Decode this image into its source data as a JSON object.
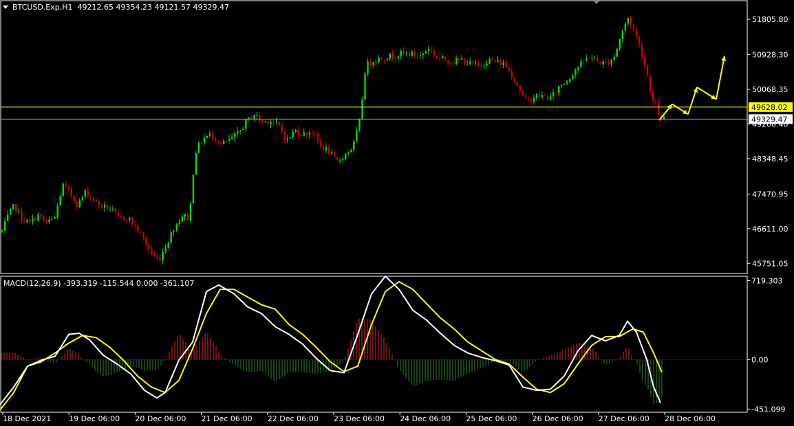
{
  "header": {
    "symbol": "BTCUSD.Exp,H1",
    "ohlc": "49212.65 49354.23 49121.57 49329.47",
    "macd_label": "MACD(12,26,9) -393.319 -115.544 0.000 -361.107"
  },
  "colors": {
    "background": "#000000",
    "bull_candle": "#00e000",
    "bear_candle": "#d00000",
    "grid_frame": "#ffffff",
    "level_line": "#ffff00",
    "bid_line": "#9aa0a8",
    "macd_line": "#ffffff",
    "signal_line": "#ffff00",
    "hist_pos": "#b02020",
    "hist_neg": "#1e6a1e",
    "arrow": "#ffff00"
  },
  "chart_data": [
    {
      "type": "candlestick",
      "title": "BTCUSD.Exp,H1",
      "ylim": [
        45500,
        52250
      ],
      "y_ticks": [
        "51805.80",
        "50928.30",
        "50068.35",
        "49208.40",
        "48348.45",
        "47470.95",
        "46611.00",
        "45751.05"
      ],
      "x_ticks": [
        "18 Dec 2021",
        "19 Dec 06:00",
        "20 Dec 06:00",
        "21 Dec 06:00",
        "22 Dec 06:00",
        "23 Dec 06:00",
        "24 Dec 06:00",
        "25 Dec 06:00",
        "26 Dec 06:00",
        "27 Dec 06:00",
        "28 Dec 06:00"
      ],
      "level_label": "49628.02",
      "bid_label": "49329.47",
      "level_value": 49628.02,
      "bid_value": 49329.47,
      "close_path": [
        [
          0,
          46550
        ],
        [
          8,
          46900
        ],
        [
          18,
          47200
        ],
        [
          28,
          46850
        ],
        [
          40,
          46750
        ],
        [
          52,
          46950
        ],
        [
          64,
          46750
        ],
        [
          76,
          46850
        ],
        [
          88,
          47700
        ],
        [
          98,
          47500
        ],
        [
          110,
          47200
        ],
        [
          122,
          47550
        ],
        [
          134,
          47300
        ],
        [
          146,
          47150
        ],
        [
          158,
          47100
        ],
        [
          170,
          46850
        ],
        [
          182,
          46900
        ],
        [
          194,
          46650
        ],
        [
          206,
          46350
        ],
        [
          218,
          45950
        ],
        [
          228,
          45850
        ],
        [
          238,
          46200
        ],
        [
          250,
          46650
        ],
        [
          262,
          46950
        ],
        [
          272,
          46850
        ],
        [
          280,
          48500
        ],
        [
          292,
          48850
        ],
        [
          305,
          48950
        ],
        [
          318,
          48700
        ],
        [
          330,
          48800
        ],
        [
          342,
          48950
        ],
        [
          354,
          49250
        ],
        [
          366,
          49450
        ],
        [
          378,
          49250
        ],
        [
          390,
          49300
        ],
        [
          402,
          49150
        ],
        [
          414,
          48800
        ],
        [
          426,
          49050
        ],
        [
          438,
          48950
        ],
        [
          450,
          49050
        ],
        [
          462,
          48650
        ],
        [
          474,
          48550
        ],
        [
          486,
          48250
        ],
        [
          498,
          48450
        ],
        [
          510,
          48650
        ],
        [
          520,
          49300
        ],
        [
          528,
          50650
        ],
        [
          540,
          50800
        ],
        [
          552,
          50850
        ],
        [
          566,
          50900
        ],
        [
          580,
          50950
        ],
        [
          594,
          50950
        ],
        [
          608,
          50900
        ],
        [
          620,
          51100
        ],
        [
          632,
          50850
        ],
        [
          644,
          50800
        ],
        [
          656,
          50750
        ],
        [
          668,
          50800
        ],
        [
          680,
          50700
        ],
        [
          694,
          50650
        ],
        [
          706,
          50800
        ],
        [
          718,
          50750
        ],
        [
          730,
          50700
        ],
        [
          742,
          50400
        ],
        [
          754,
          50000
        ],
        [
          762,
          49750
        ],
        [
          774,
          49900
        ],
        [
          786,
          49900
        ],
        [
          798,
          49850
        ],
        [
          810,
          50150
        ],
        [
          822,
          50300
        ],
        [
          832,
          50550
        ],
        [
          842,
          50700
        ],
        [
          854,
          50900
        ],
        [
          866,
          50750
        ],
        [
          878,
          50700
        ],
        [
          890,
          50900
        ],
        [
          900,
          51450
        ],
        [
          910,
          51850
        ],
        [
          918,
          51550
        ],
        [
          928,
          51050
        ],
        [
          938,
          50400
        ],
        [
          946,
          49750
        ],
        [
          952,
          49650
        ],
        [
          956,
          49250
        ],
        [
          962,
          49340
        ]
      ],
      "candle_count": 240
    },
    {
      "type": "macd",
      "title": "MACD(12,26,9)",
      "params": [
        12,
        26,
        9
      ],
      "values": {
        "macd": -393.319,
        "signal": -115.544,
        "zero": 0.0,
        "hist": -361.107
      },
      "ylim": [
        -480,
        760
      ],
      "y_ticks": [
        "719.303",
        "0.00",
        "-451.099"
      ],
      "macd_path": [
        [
          0,
          -410
        ],
        [
          20,
          -250
        ],
        [
          40,
          -60
        ],
        [
          60,
          -5
        ],
        [
          80,
          30
        ],
        [
          100,
          230
        ],
        [
          115,
          240
        ],
        [
          130,
          180
        ],
        [
          150,
          40
        ],
        [
          170,
          -40
        ],
        [
          190,
          -130
        ],
        [
          210,
          -280
        ],
        [
          228,
          -350
        ],
        [
          240,
          -300
        ],
        [
          260,
          -5
        ],
        [
          280,
          160
        ],
        [
          300,
          620
        ],
        [
          318,
          680
        ],
        [
          340,
          600
        ],
        [
          360,
          480
        ],
        [
          380,
          420
        ],
        [
          400,
          300
        ],
        [
          420,
          230
        ],
        [
          440,
          140
        ],
        [
          460,
          10
        ],
        [
          480,
          -100
        ],
        [
          500,
          -120
        ],
        [
          520,
          230
        ],
        [
          540,
          600
        ],
        [
          560,
          760
        ],
        [
          580,
          640
        ],
        [
          600,
          450
        ],
        [
          620,
          360
        ],
        [
          640,
          240
        ],
        [
          660,
          130
        ],
        [
          680,
          60
        ],
        [
          700,
          20
        ],
        [
          720,
          -10
        ],
        [
          740,
          -50
        ],
        [
          760,
          -250
        ],
        [
          780,
          -280
        ],
        [
          800,
          -270
        ],
        [
          820,
          -150
        ],
        [
          840,
          80
        ],
        [
          860,
          220
        ],
        [
          880,
          170
        ],
        [
          900,
          220
        ],
        [
          912,
          350
        ],
        [
          925,
          250
        ],
        [
          940,
          0
        ],
        [
          950,
          -250
        ],
        [
          960,
          -393
        ]
      ],
      "signal_path": [
        [
          0,
          -460
        ],
        [
          20,
          -300
        ],
        [
          40,
          -60
        ],
        [
          60,
          -20
        ],
        [
          80,
          60
        ],
        [
          100,
          150
        ],
        [
          120,
          220
        ],
        [
          140,
          200
        ],
        [
          160,
          110
        ],
        [
          180,
          -10
        ],
        [
          200,
          -150
        ],
        [
          220,
          -250
        ],
        [
          240,
          -300
        ],
        [
          260,
          -190
        ],
        [
          280,
          100
        ],
        [
          300,
          420
        ],
        [
          320,
          640
        ],
        [
          340,
          640
        ],
        [
          360,
          570
        ],
        [
          380,
          500
        ],
        [
          400,
          460
        ],
        [
          420,
          320
        ],
        [
          440,
          230
        ],
        [
          460,
          110
        ],
        [
          480,
          -20
        ],
        [
          500,
          -110
        ],
        [
          520,
          -60
        ],
        [
          540,
          320
        ],
        [
          560,
          620
        ],
        [
          580,
          710
        ],
        [
          600,
          640
        ],
        [
          620,
          510
        ],
        [
          640,
          380
        ],
        [
          660,
          280
        ],
        [
          680,
          160
        ],
        [
          700,
          80
        ],
        [
          720,
          0
        ],
        [
          740,
          -40
        ],
        [
          760,
          -160
        ],
        [
          780,
          -270
        ],
        [
          800,
          -300
        ],
        [
          820,
          -220
        ],
        [
          840,
          -40
        ],
        [
          860,
          130
        ],
        [
          880,
          210
        ],
        [
          900,
          210
        ],
        [
          920,
          280
        ],
        [
          935,
          250
        ],
        [
          950,
          60
        ],
        [
          962,
          -115
        ]
      ]
    }
  ],
  "arrows": "forecast zig-zag arrows (yellow)"
}
